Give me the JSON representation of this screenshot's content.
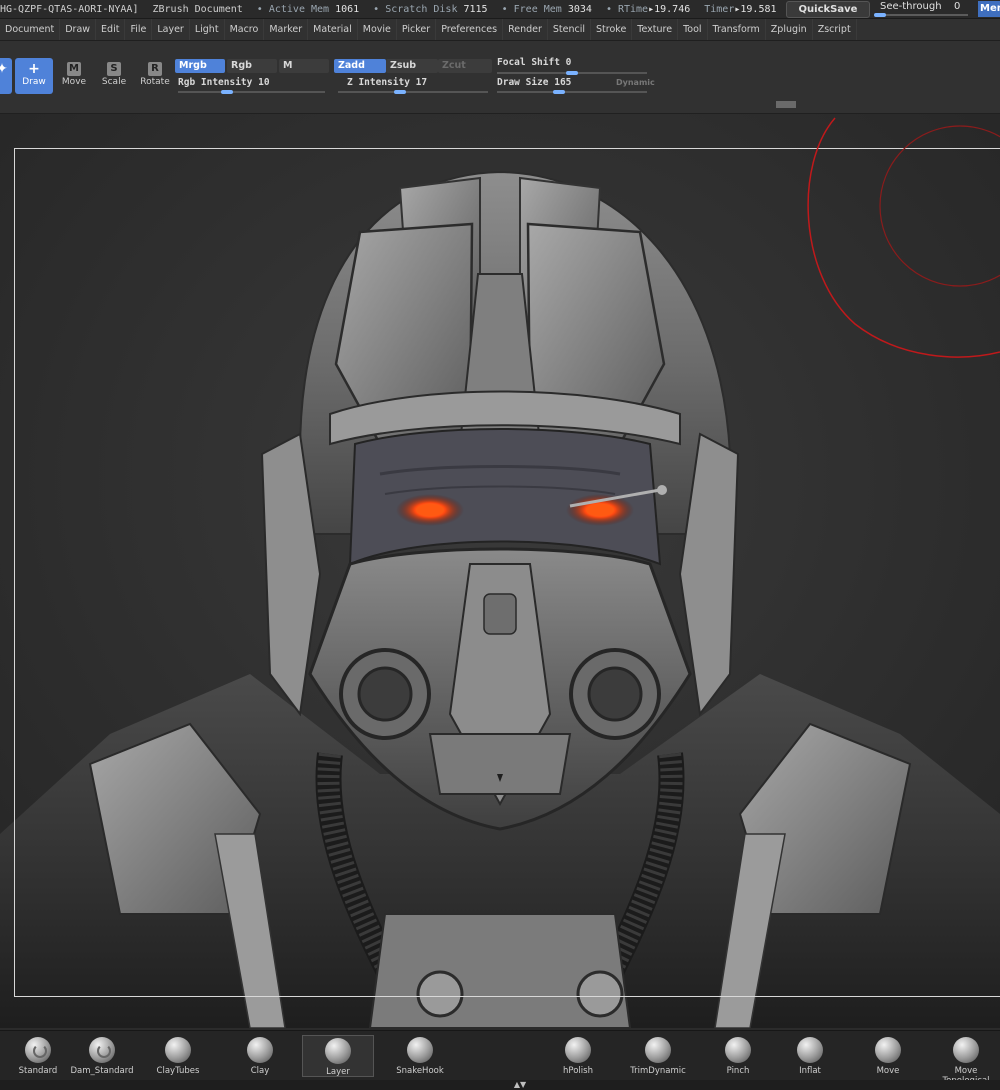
{
  "title_bar": {
    "doc_id": "HG-QZPF-QTAS-AORI-NYAA]",
    "app_title": "ZBrush Document",
    "stats": [
      {
        "label": "• Active Mem",
        "value": "1061"
      },
      {
        "label": "• Scratch Disk",
        "value": "7115"
      },
      {
        "label": "• Free Mem",
        "value": "3034"
      },
      {
        "label": "• RTime",
        "value": "▸19.746"
      },
      {
        "label": "Timer",
        "value": "▸19.581"
      }
    ],
    "quicksave_label": "QuickSave",
    "see_through_label": "See-through",
    "see_through_value": "0",
    "see_through_level": 0,
    "menus_label": "Menu"
  },
  "menu_bar": {
    "items": [
      "Document",
      "Draw",
      "Edit",
      "File",
      "Layer",
      "Light",
      "Macro",
      "Marker",
      "Material",
      "Movie",
      "Picker",
      "Preferences",
      "Render",
      "Stencil",
      "Stroke",
      "Texture",
      "Tool",
      "Transform",
      "Zplugin",
      "Zscript"
    ]
  },
  "shelf": {
    "tools": [
      {
        "label": "Draw",
        "glyph": "+",
        "active": true
      },
      {
        "label": "Move",
        "glyph": "M",
        "active": false
      },
      {
        "label": "Scale",
        "glyph": "S",
        "active": false
      },
      {
        "label": "Rotate",
        "glyph": "R",
        "active": false
      }
    ],
    "mrgb_label": "Mrgb",
    "rgb_label": "Rgb",
    "m_label": "M",
    "rgb_intensity_label": "Rgb Intensity",
    "rgb_intensity_value": "10",
    "zadd_label": "Zadd",
    "zsub_label": "Zsub",
    "zcut_label": "Zcut",
    "z_intensity_label": "Z Intensity",
    "z_intensity_value": "17",
    "focal_shift_label": "Focal Shift",
    "focal_shift_value": "0",
    "draw_size_label": "Draw Size",
    "draw_size_value": "165",
    "dynamic_label": "Dynamic"
  },
  "colors": {
    "accent": "#4f82d9",
    "slider_knob": "#7ab2ff",
    "brush_cursor": "#c0191b",
    "eye_glow": "#ff4a10"
  },
  "brushes": [
    {
      "label": "Standard",
      "icon": "standard-brush-icon",
      "active": false
    },
    {
      "label": "Dam_Standard",
      "icon": "dam-standard-brush-icon",
      "active": false
    },
    {
      "label": "ClayTubes",
      "icon": "claytubes-brush-icon",
      "active": false
    },
    {
      "label": "Clay",
      "icon": "clay-brush-icon",
      "active": false
    },
    {
      "label": "Layer",
      "icon": "layer-brush-icon",
      "active": true
    },
    {
      "label": "SnakeHook",
      "icon": "snakehook-brush-icon",
      "active": false
    },
    {
      "label": "hPolish",
      "icon": "hpolish-brush-icon",
      "active": false
    },
    {
      "label": "TrimDynamic",
      "icon": "trimdynamic-brush-icon",
      "active": false
    },
    {
      "label": "Pinch",
      "icon": "pinch-brush-icon",
      "active": false
    },
    {
      "label": "Inflat",
      "icon": "inflat-brush-icon",
      "active": false
    },
    {
      "label": "Move",
      "icon": "move-brush-icon",
      "active": false
    },
    {
      "label": "Move Topological",
      "icon": "move-topological-brush-icon",
      "active": false
    }
  ]
}
